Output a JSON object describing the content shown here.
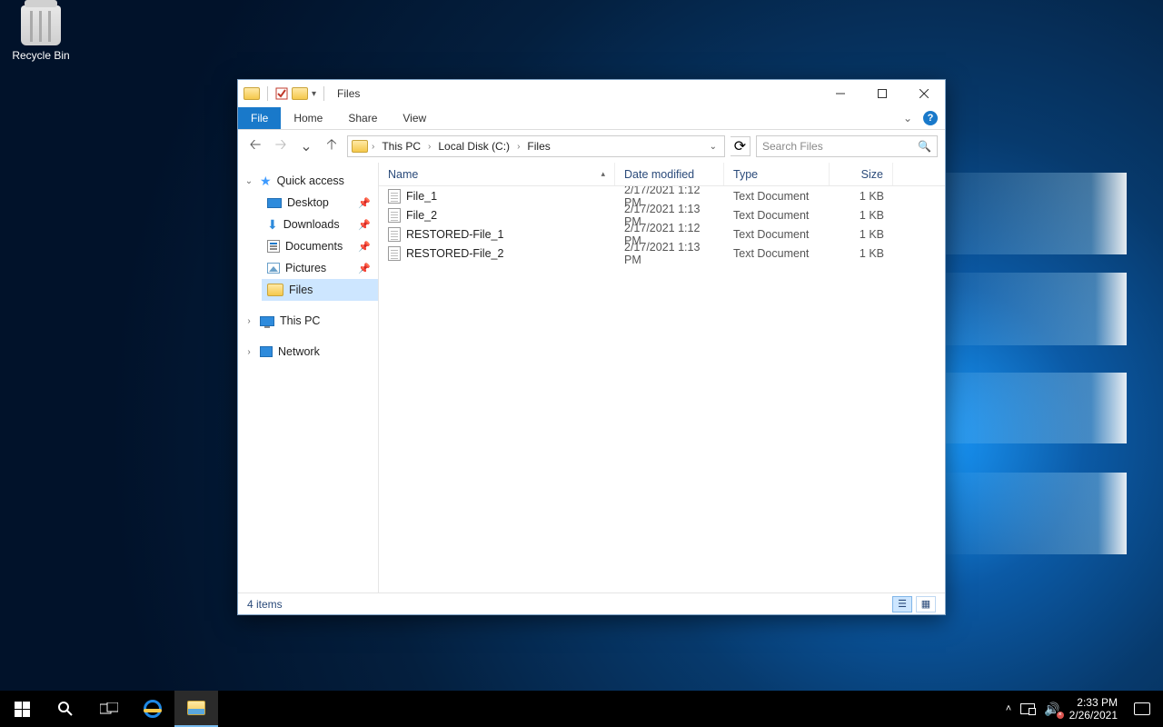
{
  "desktop": {
    "recycle_bin": "Recycle Bin"
  },
  "window": {
    "title": "Files",
    "quick_access_toolbar": {
      "items": [
        "folder",
        "properties",
        "new-folder"
      ]
    },
    "controls": {
      "min": "—",
      "max": "□",
      "close": "✕"
    },
    "tabs": {
      "file": "File",
      "home": "Home",
      "share": "Share",
      "view": "View"
    },
    "nav": {
      "back_enabled": true,
      "forward_enabled": false,
      "breadcrumbs": [
        "This PC",
        "Local Disk (C:)",
        "Files"
      ],
      "refresh": "↻",
      "search_placeholder": "Search Files"
    },
    "tree": {
      "quick_access": "Quick access",
      "items": [
        {
          "label": "Desktop",
          "pinned": true
        },
        {
          "label": "Downloads",
          "pinned": true
        },
        {
          "label": "Documents",
          "pinned": true
        },
        {
          "label": "Pictures",
          "pinned": true
        },
        {
          "label": "Files",
          "pinned": false,
          "selected": true
        }
      ],
      "this_pc": "This PC",
      "network": "Network"
    },
    "columns": {
      "name": "Name",
      "date": "Date modified",
      "type": "Type",
      "size": "Size",
      "sort_on": "name",
      "sort_dir": "asc"
    },
    "files": [
      {
        "name": "File_1",
        "date": "2/17/2021 1:12 PM",
        "type": "Text Document",
        "size": "1 KB"
      },
      {
        "name": "File_2",
        "date": "2/17/2021 1:13 PM",
        "type": "Text Document",
        "size": "1 KB"
      },
      {
        "name": "RESTORED-File_1",
        "date": "2/17/2021 1:12 PM",
        "type": "Text Document",
        "size": "1 KB"
      },
      {
        "name": "RESTORED-File_2",
        "date": "2/17/2021 1:13 PM",
        "type": "Text Document",
        "size": "1 KB"
      }
    ],
    "status": {
      "text": "4 items"
    }
  },
  "taskbar": {
    "time": "2:33 PM",
    "date": "2/26/2021"
  }
}
